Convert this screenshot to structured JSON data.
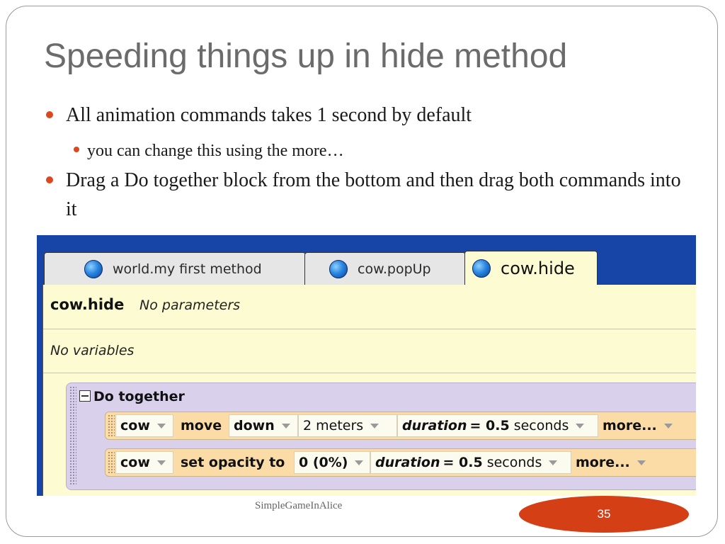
{
  "slide": {
    "title": "Speeding things up in hide method",
    "bullets": [
      "All animation commands takes 1 second by default",
      "you can change this using the more…",
      "Drag a Do together block from the bottom and then drag both commands into it"
    ],
    "footer": "SimpleGameInAlice",
    "page_number": "35"
  },
  "alice": {
    "tabs": [
      {
        "label": "world.my first method",
        "icon": "blue-ball-icon"
      },
      {
        "label": "cow.popUp",
        "icon": "blue-ball-icon"
      },
      {
        "label": "cow.hide",
        "icon": "blue-ball-icon",
        "active": true
      }
    ],
    "method_name": "cow.hide",
    "parameters": "No parameters",
    "variables": "No variables",
    "do_together_label": "Do together",
    "commands": [
      {
        "object": "cow",
        "action": "move",
        "direction": "down",
        "amount": "2 meters",
        "duration_label": "duration",
        "duration_eq": "= 0.5",
        "duration_unit": "seconds",
        "more": "more..."
      },
      {
        "object": "cow",
        "action": "set opacity to",
        "amount": "0 (0%)",
        "duration_label": "duration",
        "duration_eq": "= 0.5",
        "duration_unit": "seconds",
        "more": "more..."
      }
    ],
    "colors": {
      "background": "#1645a7",
      "editor": "#fdfbd2",
      "do_together": "#d9d1ec",
      "command": "#fbdca6"
    }
  },
  "colors": {
    "accent": "#d9481e",
    "title": "#6b6b6b"
  }
}
